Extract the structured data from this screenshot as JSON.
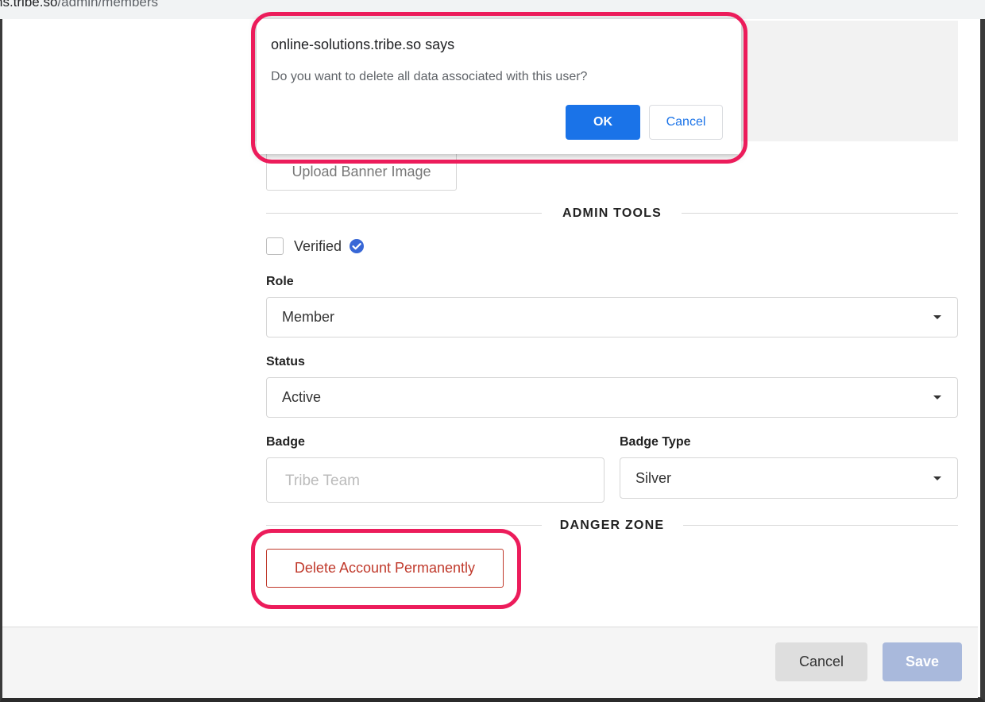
{
  "browser": {
    "url_host": "ns.tribe.so",
    "url_path": "/admin/members"
  },
  "form": {
    "upload_banner_label": "Upload Banner Image",
    "admin_tools_title": "ADMIN TOOLS",
    "verified_label": "Verified",
    "verified_checked": false,
    "role_label": "Role",
    "role_value": "Member",
    "status_label": "Status",
    "status_value": "Active",
    "badge_label": "Badge",
    "badge_placeholder": "Tribe Team",
    "badge_type_label": "Badge Type",
    "badge_type_value": "Silver",
    "danger_zone_title": "DANGER ZONE",
    "delete_account_label": "Delete Account Permanently"
  },
  "footer": {
    "cancel_label": "Cancel",
    "save_label": "Save"
  },
  "dialog": {
    "title": "online-solutions.tribe.so says",
    "message": "Do you want to delete all data associated with this user?",
    "ok_label": "OK",
    "cancel_label": "Cancel"
  },
  "colors": {
    "highlight": "#ec1c5b",
    "primary_blue": "#1a73e8",
    "danger_red": "#c0392b",
    "save_disabled": "#a9b9dc",
    "verified_blue": "#3867d6"
  },
  "icons": {
    "verified": "verified-check-icon",
    "dropdown": "caret-down-icon"
  }
}
